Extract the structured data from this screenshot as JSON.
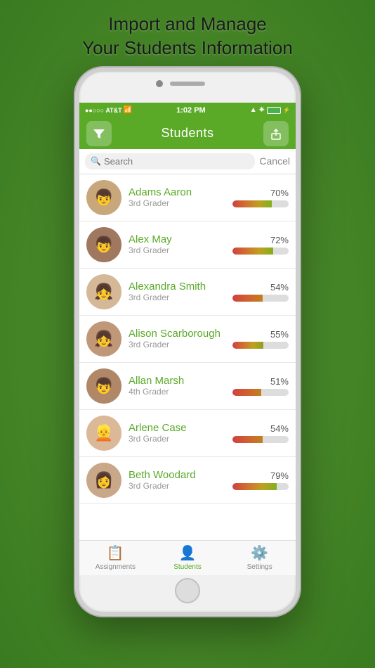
{
  "header": {
    "line1": "Import and Manage",
    "line2": "Your Students Information"
  },
  "status_bar": {
    "carrier": "●●○○○ AT&T",
    "wifi": "WiFi",
    "time": "1:02 PM",
    "location": "▲",
    "bluetooth": "✴",
    "battery": "Battery"
  },
  "nav": {
    "title": "Students",
    "filter_label": "filter-icon",
    "share_label": "share-icon"
  },
  "search": {
    "placeholder": "Search",
    "cancel_label": "Cancel"
  },
  "students": [
    {
      "name": "Adams Aaron",
      "grade": "3rd Grader",
      "score": 70,
      "avatar": "👦"
    },
    {
      "name": "Alex May",
      "grade": "3rd Grader",
      "score": 72,
      "avatar": "👦"
    },
    {
      "name": "Alexandra Smith",
      "grade": "3rd Grader",
      "score": 54,
      "avatar": "👧"
    },
    {
      "name": "Alison Scarborough",
      "grade": "3rd Grader",
      "score": 55,
      "avatar": "👧"
    },
    {
      "name": "Allan Marsh",
      "grade": "4th Grader",
      "score": 51,
      "avatar": "👦"
    },
    {
      "name": "Arlene Case",
      "grade": "3rd Grader",
      "score": 54,
      "avatar": "👱"
    },
    {
      "name": "Beth Woodard",
      "grade": "3rd Grader",
      "score": 79,
      "avatar": "👩"
    }
  ],
  "tabs": [
    {
      "id": "assignments",
      "label": "Assignments",
      "icon": "📋",
      "active": false
    },
    {
      "id": "students",
      "label": "Students",
      "icon": "👤",
      "active": true
    },
    {
      "id": "settings",
      "label": "Settings",
      "icon": "⚙️",
      "active": false
    }
  ],
  "colors": {
    "green": "#5aaa28",
    "accent": "#5aaa28"
  }
}
